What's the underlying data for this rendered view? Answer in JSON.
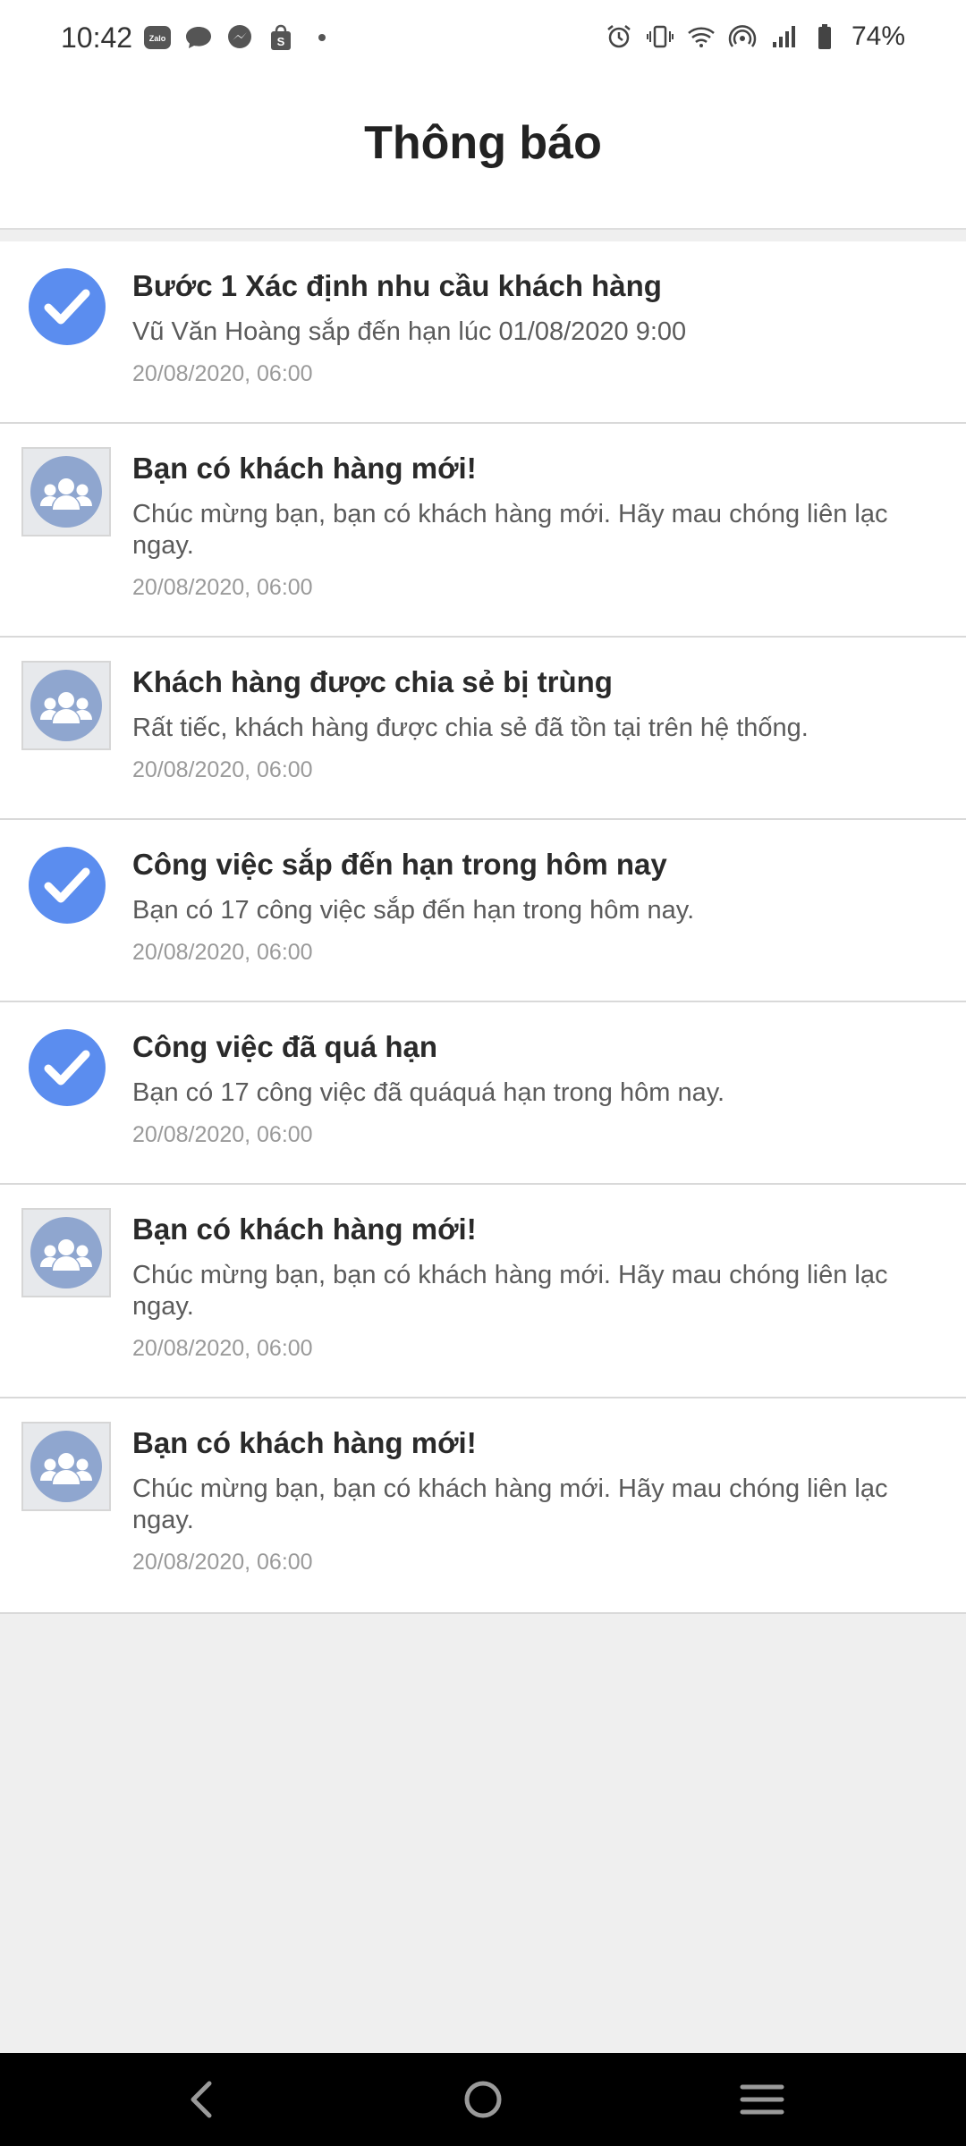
{
  "status_bar": {
    "time": "10:42",
    "battery": "74%",
    "left_icons": [
      "zalo-icon",
      "chat-bubble-icon",
      "messenger-icon",
      "shopee-icon",
      "dot-icon"
    ],
    "right_icons": [
      "alarm-icon",
      "vibrate-icon",
      "wifi-icon",
      "hotspot-icon",
      "signal-icon",
      "battery-icon"
    ]
  },
  "header": {
    "title": "Thông báo"
  },
  "notifications": [
    {
      "icon": "check-circle-icon",
      "title": "Bước 1 Xác định nhu cầu khách hàng",
      "body": "Vũ Văn Hoàng sắp đến hạn lúc 01/08/2020 9:00",
      "time": "20/08/2020, 06:00"
    },
    {
      "icon": "group-avatar-icon",
      "title": "Bạn có khách hàng mới!",
      "body": "Chúc mừng bạn, bạn có khách hàng mới. Hãy mau chóng liên lạc ngay.",
      "time": "20/08/2020, 06:00"
    },
    {
      "icon": "group-avatar-icon",
      "title": "Khách hàng được chia sẻ bị trùng",
      "body": "Rất tiếc, khách hàng được chia sẻ đã tồn tại trên hệ thống.",
      "time": "20/08/2020, 06:00"
    },
    {
      "icon": "check-circle-icon",
      "title": "Công việc sắp đến hạn trong hôm nay",
      "body": "Bạn có 17 công việc sắp đến hạn trong hôm nay.",
      "time": "20/08/2020, 06:00"
    },
    {
      "icon": "check-circle-icon",
      "title": "Công việc đã quá hạn",
      "body": "Bạn có 17 công việc đã quáquá hạn trong hôm nay.",
      "time": "20/08/2020, 06:00"
    },
    {
      "icon": "group-avatar-icon",
      "title": "Bạn có khách hàng mới!",
      "body": "Chúc mừng bạn, bạn có khách hàng mới. Hãy mau chóng liên lạc ngay.",
      "time": "20/08/2020, 06:00"
    },
    {
      "icon": "group-avatar-icon",
      "title": "Bạn có khách hàng mới!",
      "body": "Chúc mừng bạn, bạn có khách hàng mới. Hãy mau chóng liên lạc ngay.",
      "time": "20/08/2020, 06:00"
    }
  ],
  "nav_bar": {
    "icons": [
      "back-icon",
      "home-icon",
      "recents-icon"
    ]
  },
  "colors": {
    "accent": "#5b8def",
    "avatar_bg": "#8fa6cf",
    "page_bg": "#efefef"
  }
}
